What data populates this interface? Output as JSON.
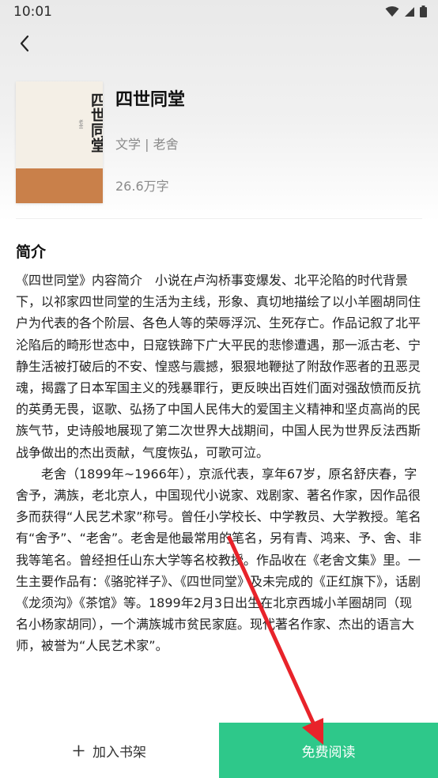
{
  "status_bar": {
    "time": "10:01",
    "icons": [
      "wifi-icon",
      "signal-icon",
      "battery-icon"
    ]
  },
  "header": {
    "back_icon": "chevron-left-icon"
  },
  "book": {
    "cover_title": "四世同堂",
    "title": "四世同堂",
    "meta": "文学 | 老舍",
    "word_count": "26.6万字"
  },
  "intro": {
    "heading": "简介",
    "paragraphs": [
      "《四世同堂》内容简介　小说在卢沟桥事变爆发、北平沦陷的时代背景下，以祁家四世同堂的生活为主线，形象、真切地描绘了以小羊圈胡同住户为代表的各个阶层、各色人等的荣辱浮沉、生死存亡。作品记叙了北平沦陷后的畸形世态中，日寇铁蹄下广大平民的悲惨遭遇，那一派古老、宁静生活被打破后的不安、惶惑与震撼，狠狠地鞭挞了附敌作恶者的丑恶灵魂，揭露了日本军国主义的残暴罪行，更反映出百姓们面对强敌愤而反抗的英勇无畏，讴歌、弘扬了中国人民伟大的爱国主义精神和坚贞高尚的民族气节，史诗般地展现了第二次世界大战期间，中国人民为世界反法西斯战争做出的杰出贡献，气度恢弘，可歌可泣。",
      "老舍（1899年~1966年），京派代表，享年67岁，原名舒庆春，字舍予，满族，老北京人，中国现代小说家、戏剧家、著名作家，因作品很多而获得“人民艺术家”称号。曾任小学校长、中学教员、大学教授。笔名有“舍予”、“老舍”。老舍是他最常用的笔名，另有青、鸿来、予、舍、非我等笔名。曾经担任山东大学等名校教授。作品收在《老舍文集》里。一生主要作品有：《骆驼祥子》、《四世同堂》及未完成的《正红旗下》，话剧《龙须沟》《茶馆》等。1899年2月3日出生在北京西城小羊圈胡同（现名小杨家胡同），一个满族城市贫民家庭。现代著名作家、杰出的语言大师，被誉为“人民艺术家”。"
    ]
  },
  "bottom_bar": {
    "shelf_label": "加入书架",
    "shelf_icon": "plus-icon",
    "read_label": "免费阅读",
    "read_color": "#2ec88a"
  },
  "annotation": {
    "arrow_color": "#e8232a"
  }
}
